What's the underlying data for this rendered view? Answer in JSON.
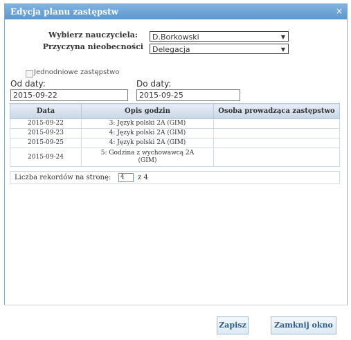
{
  "dialog": {
    "title": "Edycja planu zastępstw",
    "close_icon": "×"
  },
  "form": {
    "teacher_label": "Wybierz nauczyciela:",
    "teacher_value": "D.Borkowski",
    "reason_label": "Przyczyna nieobecności",
    "reason_value": "Delegacja",
    "one_day_label": "Jednodniowe zastępstwo",
    "from_label": "Od daty:",
    "from_value": "2015-09-22",
    "to_label": "Do daty:",
    "to_value": "2015-09-25"
  },
  "table": {
    "headers": [
      "Data",
      "Opis godzin",
      "Osoba prowadząca zastępstwo"
    ],
    "rows": [
      [
        "2015-09-22",
        "3: Język polski 2A (GIM)",
        ""
      ],
      [
        "2015-09-23",
        "4: Język polski 2A (GIM)",
        ""
      ],
      [
        "2015-09-25",
        "4: Język polski 2A (GIM)",
        ""
      ],
      [
        "2015-09-24",
        "5: Godzina z wychowawcą 2A (GIM)",
        ""
      ]
    ],
    "per_page_label": "Liczba rekordów na stronę:",
    "per_page_value": "4",
    "total_label": "z 4"
  },
  "buttons": {
    "save": "Zapisz",
    "close": "Zamknij okno"
  }
}
